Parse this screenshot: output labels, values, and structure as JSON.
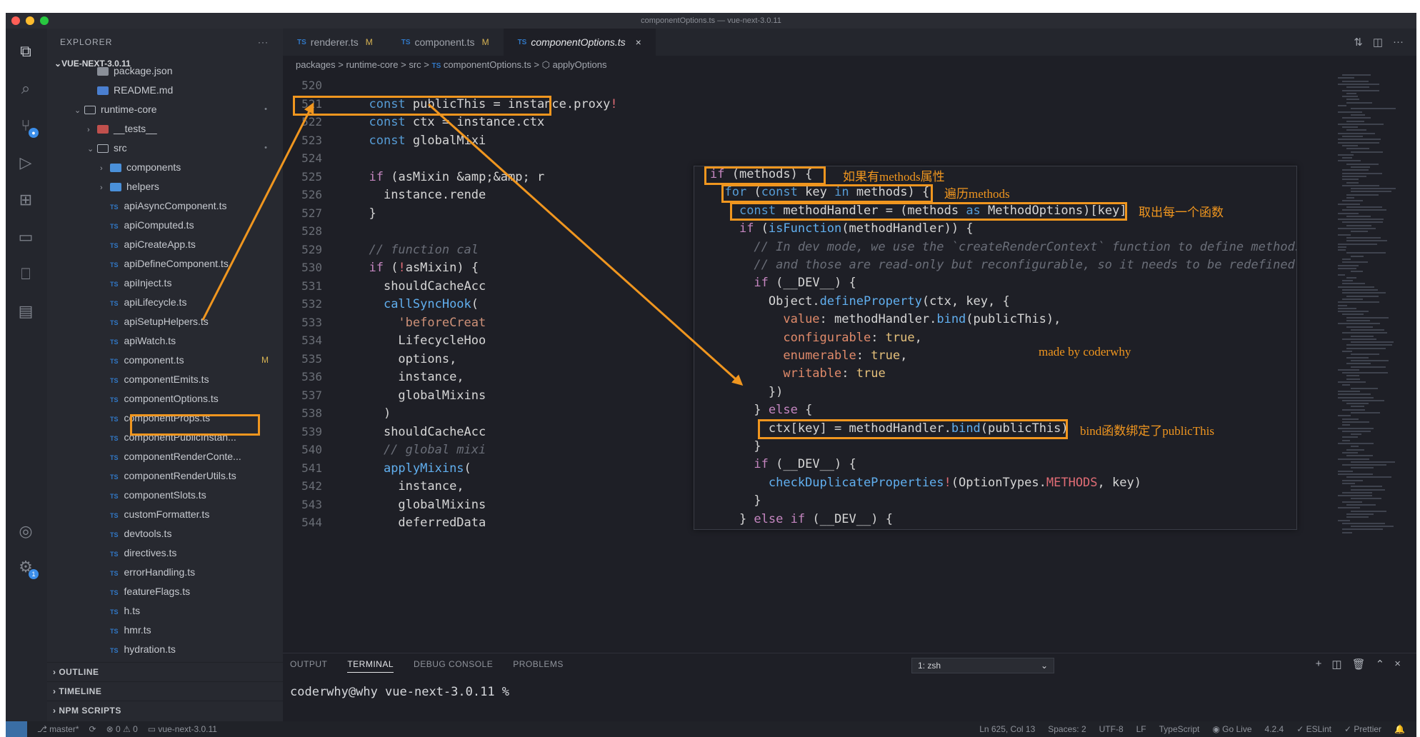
{
  "window": {
    "title": "componentOptions.ts — vue-next-3.0.11"
  },
  "sidebar": {
    "title": "EXPLORER",
    "more": "···",
    "root": "VUE-NEXT-3.0.11",
    "items": [
      {
        "label": "package.json"
      },
      {
        "label": "README.md"
      },
      {
        "label": "runtime-core",
        "status": "•"
      },
      {
        "label": "__tests__"
      },
      {
        "label": "src",
        "status": "•"
      },
      {
        "label": "components"
      },
      {
        "label": "helpers"
      },
      {
        "label": "apiAsyncComponent.ts"
      },
      {
        "label": "apiComputed.ts"
      },
      {
        "label": "apiCreateApp.ts"
      },
      {
        "label": "apiDefineComponent.ts"
      },
      {
        "label": "apiInject.ts"
      },
      {
        "label": "apiLifecycle.ts"
      },
      {
        "label": "apiSetupHelpers.ts"
      },
      {
        "label": "apiWatch.ts"
      },
      {
        "label": "component.ts",
        "status": "M"
      },
      {
        "label": "componentEmits.ts"
      },
      {
        "label": "componentOptions.ts"
      },
      {
        "label": "componentProps.ts"
      },
      {
        "label": "componentPublicInstan..."
      },
      {
        "label": "componentRenderConte..."
      },
      {
        "label": "componentRenderUtils.ts"
      },
      {
        "label": "componentSlots.ts"
      },
      {
        "label": "customFormatter.ts"
      },
      {
        "label": "devtools.ts"
      },
      {
        "label": "directives.ts"
      },
      {
        "label": "errorHandling.ts"
      },
      {
        "label": "featureFlags.ts"
      },
      {
        "label": "h.ts"
      },
      {
        "label": "hmr.ts"
      },
      {
        "label": "hydration.ts"
      }
    ],
    "sections": [
      "OUTLINE",
      "TIMELINE",
      "NPM SCRIPTS"
    ]
  },
  "tabs": [
    {
      "label": "renderer.ts",
      "status": "M"
    },
    {
      "label": "component.ts",
      "status": "M"
    },
    {
      "label": "componentOptions.ts",
      "close": "×"
    }
  ],
  "breadcrumb": [
    "packages",
    "runtime-core",
    "src",
    "componentOptions.ts",
    "applyOptions"
  ],
  "breadcrumb_sep": ">",
  "code": {
    "line_numbers": [
      "520",
      "521",
      "522",
      "523",
      "524",
      "525",
      "526",
      "527",
      "528",
      "529",
      "530",
      "531",
      "532",
      "533",
      "534",
      "535",
      "536",
      "537",
      "538",
      "539",
      "540",
      "541",
      "542",
      "543",
      "544"
    ],
    "lines": [
      "",
      "  const publicThis = instance.proxy!",
      "  const ctx = instance.ctx",
      "  const globalMixi",
      "",
      "  if (asMixin && r",
      "    instance.rende",
      "  }",
      "",
      "  // function cal",
      "  if (!asMixin) {",
      "    shouldCacheAcc",
      "    callSyncHook(",
      "      'beforeCreat",
      "      LifecycleHoo",
      "      options,",
      "      instance,",
      "      globalMixins",
      "    )",
      "    shouldCacheAcc",
      "    // global mixi",
      "    applyMixins(",
      "      instance,",
      "      globalMixins",
      "      deferredData"
    ]
  },
  "popup": {
    "lines": [
      "if (methods) {",
      "  for (const key in methods) {",
      "    const methodHandler = (methods as MethodOptions)[key]",
      "    if (isFunction(methodHandler)) {",
      "      // In dev mode, we use the `createRenderContext` function to define methods",
      "      // and those are read-only but reconfigurable, so it needs to be redefined h",
      "      if (__DEV__) {",
      "        Object.defineProperty(ctx, key, {",
      "          value: methodHandler.bind(publicThis),",
      "          configurable: true,",
      "          enumerable: true,",
      "          writable: true",
      "        })",
      "      } else {",
      "        ctx[key] = methodHandler.bind(publicThis)",
      "      }",
      "      if (__DEV__) {",
      "        checkDuplicateProperties!(OptionTypes.METHODS, key)",
      "      }",
      "    } else if (__DEV__) {"
    ]
  },
  "annotations": {
    "methods": "如果有methods属性",
    "loop": "遍历methods",
    "take": "取出每一个函数",
    "bind": "bind函数绑定了publicThis",
    "credit": "made by coderwhy"
  },
  "panel": {
    "tabs": [
      "OUTPUT",
      "TERMINAL",
      "DEBUG CONSOLE",
      "PROBLEMS"
    ],
    "active": "TERMINAL",
    "shell": "1: zsh",
    "prompt": "coderwhy@why vue-next-3.0.11 %"
  },
  "status": {
    "branch": "master*",
    "errors": "⊗ 0 ⚠ 0",
    "folder": "vue-next-3.0.11",
    "position": "Ln 625, Col 13",
    "spaces": "Spaces: 2",
    "encoding": "UTF-8",
    "eol": "LF",
    "language": "TypeScript",
    "golive": "Go Live",
    "version": "4.2.4",
    "eslint": "✓ ESLint",
    "prettier": "✓ Prettier"
  },
  "colors": {
    "accent": "#f0961f",
    "background": "#1e1f26",
    "sidebar": "#272930",
    "tsIcon": "#3178c6"
  }
}
